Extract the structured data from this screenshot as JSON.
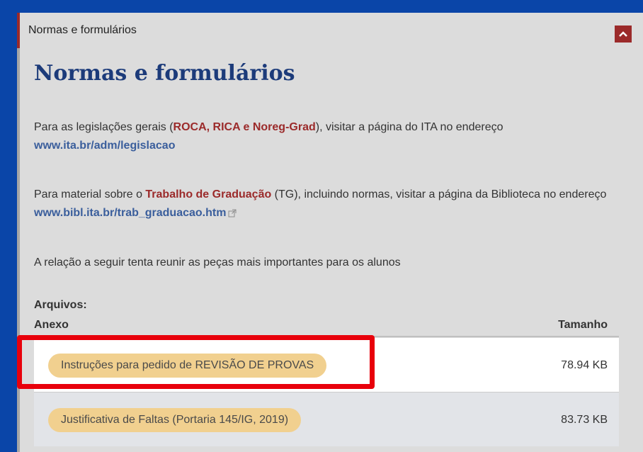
{
  "panel": {
    "header_title": "Normas e formulários",
    "collapse_icon": "chevron-up-icon",
    "accent_color": "#9b2a2a"
  },
  "content": {
    "title": "Normas e formulários",
    "p1": {
      "before": "Para as legislações gerais (",
      "highlight": "ROCA, RICA e Noreg-Grad",
      "after": "), visitar a página do ITA no endereço ",
      "link": "www.ita.br/adm/legislacao"
    },
    "p2": {
      "before": "Para material sobre o ",
      "highlight": "Trabalho de Graduação",
      "after": " (TG), incluindo normas, visitar a página da Biblioteca no endereço ",
      "link": "www.bibl.ita.br/trab_graduacao.htm"
    },
    "p3": "A relação a seguir tenta reunir as peças mais importantes para os alunos",
    "files_label": "Arquivos:",
    "table": {
      "headers": [
        "Anexo",
        "Tamanho"
      ],
      "rows": [
        {
          "name": "Instruções para pedido de REVISÃO DE PROVAS",
          "size": "78.94 KB"
        },
        {
          "name": "Justificativa de Faltas (Portaria 145/IG, 2019)",
          "size": "83.73 KB"
        }
      ]
    }
  },
  "annotation": {
    "highlight_color": "#e8000b"
  }
}
